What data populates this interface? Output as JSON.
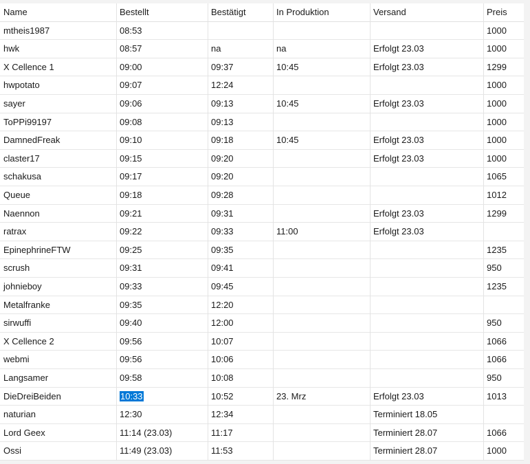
{
  "table": {
    "columns": [
      "Name",
      "Bestellt",
      "Bestätigt",
      "In Produktion",
      "Versand",
      "Preis"
    ],
    "rows": [
      [
        "mtheis1987",
        "08:53",
        "",
        "",
        "",
        "1000"
      ],
      [
        "hwk",
        "08:57",
        "na",
        "na",
        "Erfolgt 23.03",
        "1000"
      ],
      [
        "X Cellence 1",
        "09:00",
        "09:37",
        "10:45",
        "Erfolgt 23.03",
        "1299"
      ],
      [
        "hwpotato",
        "09:07",
        "12:24",
        "",
        "",
        "1000"
      ],
      [
        "sayer",
        "09:06",
        "09:13",
        "10:45",
        "Erfolgt 23.03",
        "1000"
      ],
      [
        "ToPPi99197",
        "09:08",
        "09:13",
        "",
        "",
        "1000"
      ],
      [
        "DamnedFreak",
        "09:10",
        "09:18",
        "10:45",
        "Erfolgt 23.03",
        "1000"
      ],
      [
        "claster17",
        "09:15",
        "09:20",
        "",
        "Erfolgt 23.03",
        "1000"
      ],
      [
        "schakusa",
        "09:17",
        "09:20",
        "",
        "",
        "1065"
      ],
      [
        "Queue",
        "09:18",
        "09:28",
        "",
        "",
        "1012"
      ],
      [
        "Naennon",
        "09:21",
        "09:31",
        "",
        "Erfolgt 23.03",
        "1299"
      ],
      [
        "ratrax",
        "09:22",
        "09:33",
        "11:00",
        "Erfolgt 23.03",
        ""
      ],
      [
        "EpinephrineFTW",
        "09:25",
        "09:35",
        "",
        "",
        "1235"
      ],
      [
        "scrush",
        "09:31",
        "09:41",
        "",
        "",
        "950"
      ],
      [
        "johnieboy",
        "09:33",
        "09:45",
        "",
        "",
        "1235"
      ],
      [
        "Metalfranke",
        "09:35",
        "12:20",
        "",
        "",
        ""
      ],
      [
        "sirwuffi",
        "09:40",
        "12:00",
        "",
        "",
        "950"
      ],
      [
        "X Cellence 2",
        "09:56",
        "10:07",
        "",
        "",
        "1066"
      ],
      [
        "webmi",
        "09:56",
        "10:06",
        "",
        "",
        "1066"
      ],
      [
        "Langsamer",
        "09:58",
        "10:08",
        "",
        "",
        "950"
      ],
      [
        "DieDreiBeiden",
        "10:33",
        "10:52",
        "23. Mrz",
        "Erfolgt 23.03",
        "1013"
      ],
      [
        "naturian",
        "12:30",
        "12:34",
        "",
        "Terminiert 18.05",
        ""
      ],
      [
        "Lord Geex",
        "11:14 (23.03)",
        "11:17",
        "",
        "Terminiert 28.07",
        "1066"
      ],
      [
        "Ossi",
        "11:49 (23.03)",
        "11:53",
        "",
        "Terminiert 28.07",
        "1000"
      ]
    ],
    "selected": {
      "row": 20,
      "col": 1
    },
    "colors": {
      "selection": "#0078d7",
      "grid": "#e3e3e3",
      "background": "#ffffff"
    }
  }
}
